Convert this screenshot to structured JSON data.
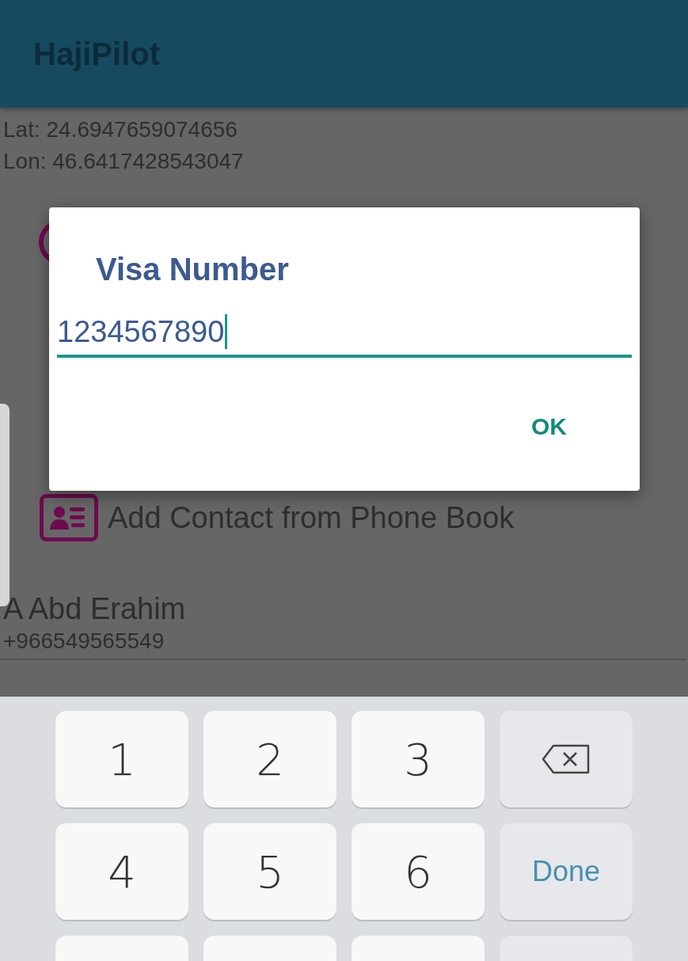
{
  "app_bar": {
    "title": "HajiPilot"
  },
  "location": {
    "lat": "Lat: 24.6947659074656",
    "lon": "Lon: 46.6417428543047"
  },
  "add_contact": {
    "label": "Add Contact from Phone Book"
  },
  "contacts": [
    {
      "name": "A Abd Erahim",
      "phone": "+966549565549"
    }
  ],
  "dialog": {
    "title": "Visa Number",
    "input": {
      "value": "1234567890"
    },
    "buttons": [
      "OK"
    ]
  },
  "keyboard": {
    "keys": [
      {
        "kind": "digit",
        "label": "1"
      },
      {
        "kind": "digit",
        "label": "2"
      },
      {
        "kind": "digit",
        "label": "3"
      },
      {
        "kind": "backspace"
      },
      {
        "kind": "digit",
        "label": "4"
      },
      {
        "kind": "digit",
        "label": "5"
      },
      {
        "kind": "digit",
        "label": "6"
      },
      {
        "kind": "action",
        "label": "Done"
      },
      {
        "kind": "blank"
      },
      {
        "kind": "blank"
      },
      {
        "kind": "blank"
      },
      {
        "kind": "blank-action"
      }
    ]
  }
}
